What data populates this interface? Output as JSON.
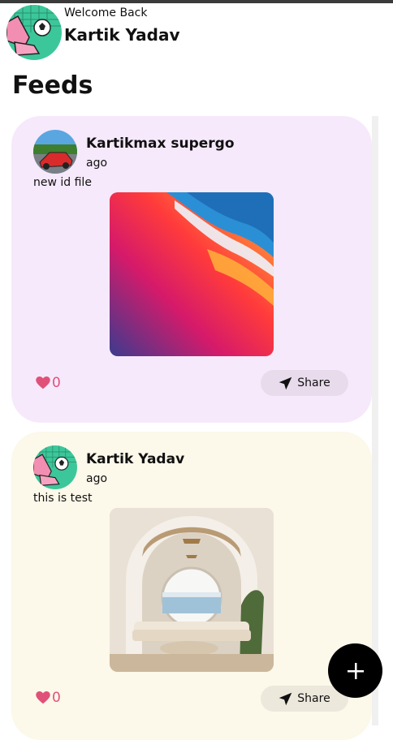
{
  "header": {
    "welcome": "Welcome Back",
    "username": "Kartik Yadav"
  },
  "page": {
    "title": "Feeds"
  },
  "posts": [
    {
      "author": "Kartikmax supergo",
      "time": "ago",
      "caption": "new id file",
      "likes": "0",
      "share_label": "Share",
      "background": "#f6e9fb"
    },
    {
      "author": "Kartik Yadav",
      "time": "ago",
      "caption": "this is test",
      "likes": "0",
      "share_label": "Share",
      "background": "#fcf8ea"
    }
  ],
  "fab": {
    "icon": "plus-icon"
  },
  "colors": {
    "accent_like": "#e0517a",
    "fab": "#000000"
  }
}
